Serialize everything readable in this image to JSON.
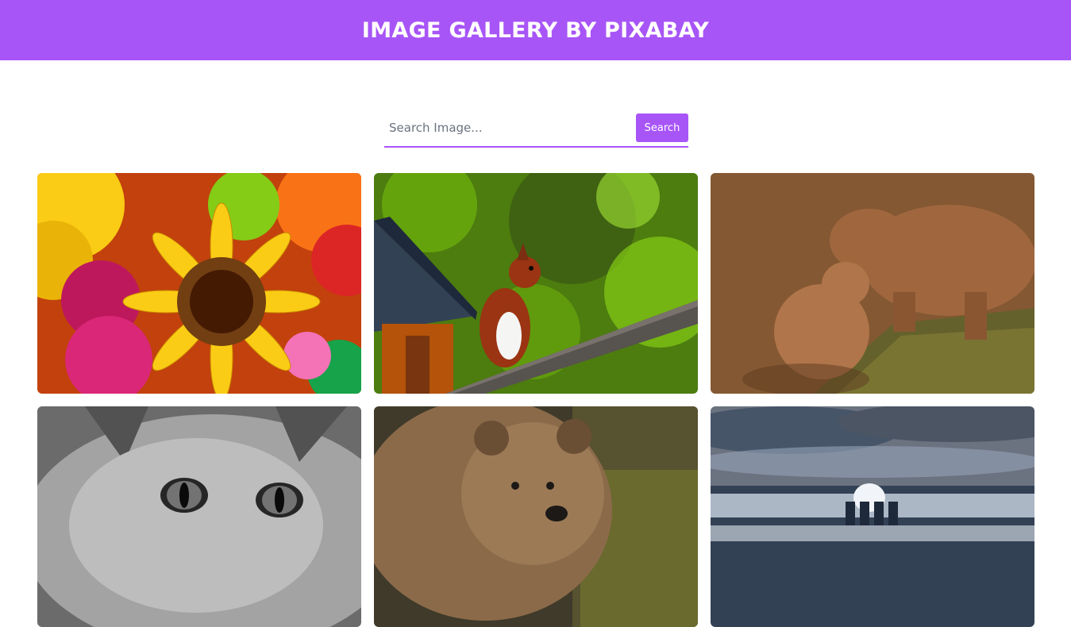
{
  "header": {
    "title": "IMAGE GALLERY BY PIXABAY"
  },
  "search": {
    "placeholder": "Search Image...",
    "value": "",
    "button_label": "Search"
  },
  "gallery": {
    "images": [
      {
        "subject": "sunflower-bouquet"
      },
      {
        "subject": "squirrel-on-plank"
      },
      {
        "subject": "bears-at-water"
      },
      {
        "subject": "tabby-cat-grayscale"
      },
      {
        "subject": "brown-bear"
      },
      {
        "subject": "sea-groyne"
      }
    ]
  },
  "colors": {
    "accent": "#a855f7",
    "header_text": "#ffffff"
  }
}
